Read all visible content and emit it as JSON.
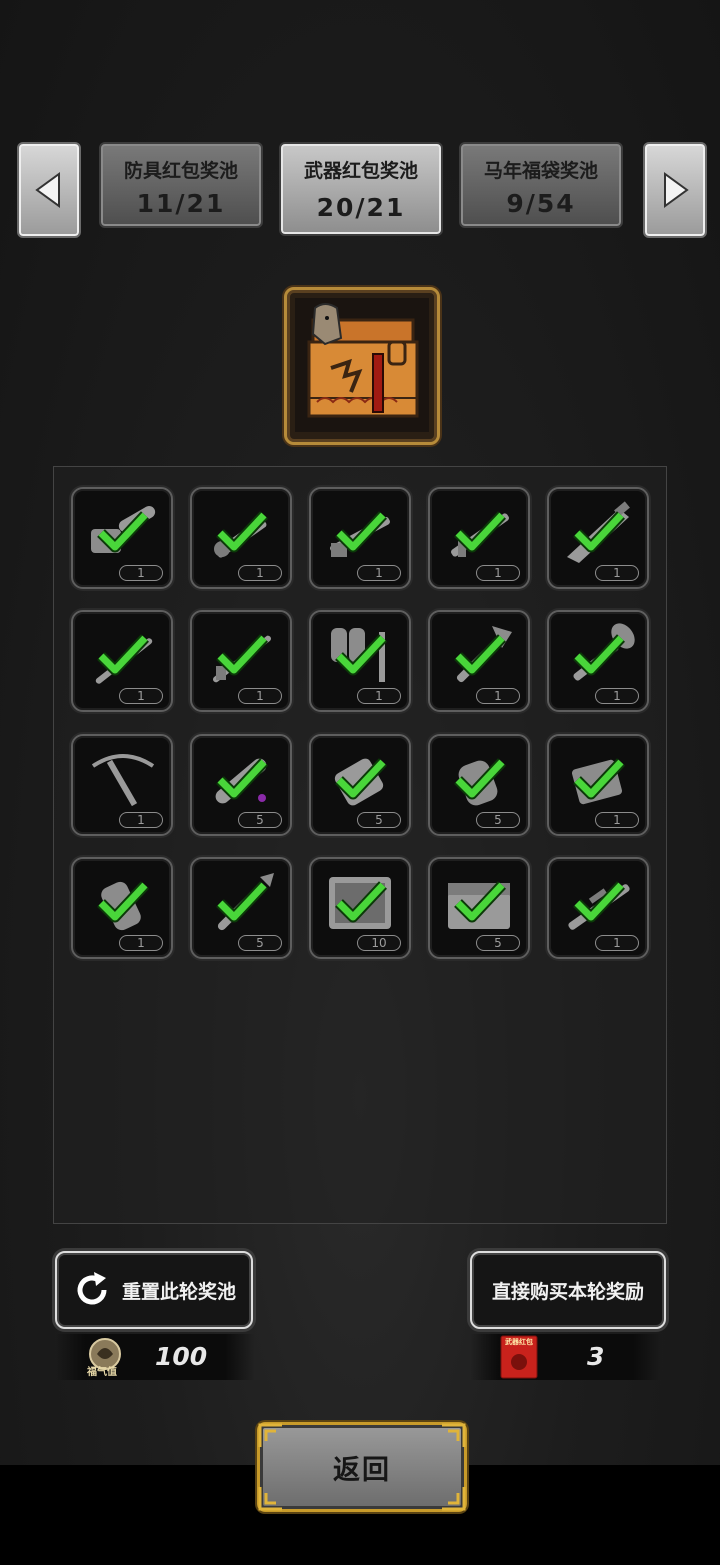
{
  "tabs": [
    {
      "name": "防具红包奖池",
      "count": "11/21",
      "active": false
    },
    {
      "name": "武器红包奖池",
      "count": "20/21",
      "active": true
    },
    {
      "name": "马年福袋奖池",
      "count": "9/54",
      "active": false
    }
  ],
  "nav": {
    "prev_icon": "left-arrow-icon",
    "next_icon": "right-arrow-icon"
  },
  "chest": {
    "icon": "horse-weapon-chest-icon"
  },
  "items": [
    {
      "icon": "chainsaw-icon",
      "qty": "1",
      "claimed": true
    },
    {
      "icon": "minigun-icon",
      "qty": "1",
      "claimed": true
    },
    {
      "icon": "shotgun-icon",
      "qty": "1",
      "claimed": true
    },
    {
      "icon": "assault-rifle-icon",
      "qty": "1",
      "claimed": true
    },
    {
      "icon": "combat-knife-icon",
      "qty": "1",
      "claimed": true
    },
    {
      "icon": "bayonet-icon",
      "qty": "1",
      "claimed": true
    },
    {
      "icon": "sniper-rifle-icon",
      "qty": "1",
      "claimed": true
    },
    {
      "icon": "flamethrower-icon",
      "qty": "1",
      "claimed": true
    },
    {
      "icon": "fire-axe-icon",
      "qty": "1",
      "claimed": true
    },
    {
      "icon": "shovel-icon",
      "qty": "1",
      "claimed": true
    },
    {
      "icon": "crossbow-icon",
      "qty": "1",
      "claimed": false
    },
    {
      "icon": "rocket-ammo-icon",
      "qty": "5",
      "claimed": true
    },
    {
      "icon": "flashbang-icon",
      "qty": "5",
      "claimed": true
    },
    {
      "icon": "frag-grenade-icon",
      "qty": "5",
      "claimed": true
    },
    {
      "icon": "explosive-pack-icon",
      "qty": "1",
      "claimed": true
    },
    {
      "icon": "smoke-grenade-icon",
      "qty": "1",
      "claimed": true
    },
    {
      "icon": "rpg-warhead-icon",
      "qty": "5",
      "claimed": true
    },
    {
      "icon": "weapon-case-icon",
      "qty": "10",
      "claimed": true
    },
    {
      "icon": "toolbox-icon",
      "qty": "5",
      "claimed": true
    },
    {
      "icon": "rifle-with-scope-icon",
      "qty": "1",
      "claimed": true
    }
  ],
  "buttons": {
    "reset_label": "重置此轮奖池",
    "buy_label": "直接购买本轮奖励",
    "back_label": "返回"
  },
  "currency": {
    "luck_value": "100",
    "luck_caption": "福气值",
    "redpacket_value": "3",
    "redpacket_caption": "武器红包"
  },
  "colors": {
    "check_green": "#49d63a",
    "frame_gold": "#c89b2a",
    "redpacket_red": "#c8221c"
  }
}
